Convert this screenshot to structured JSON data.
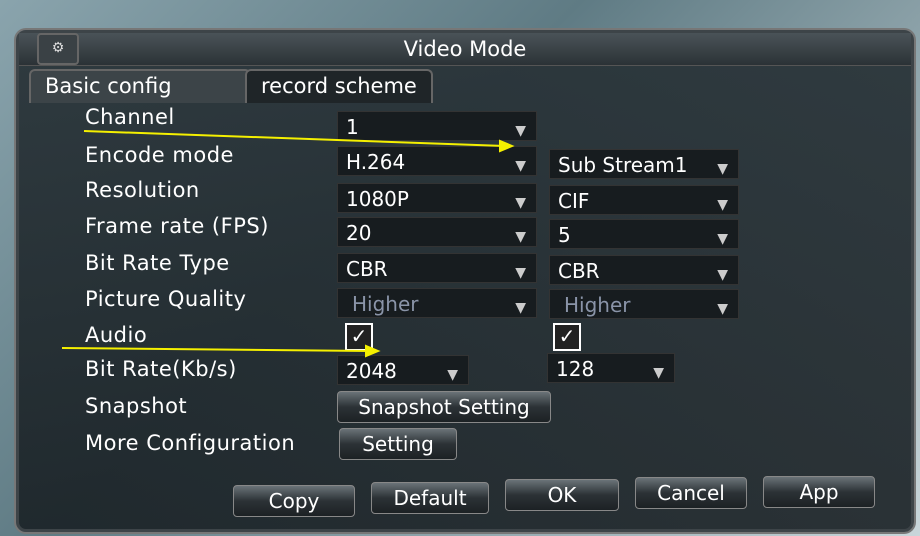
{
  "window": {
    "title": "Video Mode",
    "logo_icon": "dvr-logo-icon"
  },
  "tabs": [
    {
      "label": "Basic config",
      "active": true
    },
    {
      "label": "record scheme",
      "active": false
    }
  ],
  "rows": {
    "channel": {
      "label": "Channel",
      "main": "1"
    },
    "encode_mode": {
      "label": "Encode mode",
      "main": "H.264",
      "sub": "Sub Stream1"
    },
    "resolution": {
      "label": "Resolution",
      "main": "1080P",
      "sub": "CIF"
    },
    "frame_rate": {
      "label": "Frame rate (FPS)",
      "main": "20",
      "sub": "5"
    },
    "bit_rate_type": {
      "label": "Bit Rate Type",
      "main": "CBR",
      "sub": "CBR"
    },
    "picture_quality": {
      "label": "Picture Quality",
      "main": "Higher",
      "sub": "Higher"
    },
    "audio": {
      "label": "Audio",
      "main_checked": true,
      "sub_checked": true
    },
    "bit_rate": {
      "label": "Bit Rate(Kb/s)",
      "main": "2048",
      "sub": "128"
    },
    "snapshot": {
      "label": "Snapshot",
      "button": "Snapshot Setting"
    },
    "more": {
      "label": "More Configuration",
      "button": "Setting"
    }
  },
  "buttons": {
    "copy": "Copy",
    "default": "Default",
    "ok": "OK",
    "cancel": "Cancel",
    "apply": "App"
  },
  "colors": {
    "annotation_arrow": "#f5f000",
    "disabled_text": "#8a94a8"
  }
}
